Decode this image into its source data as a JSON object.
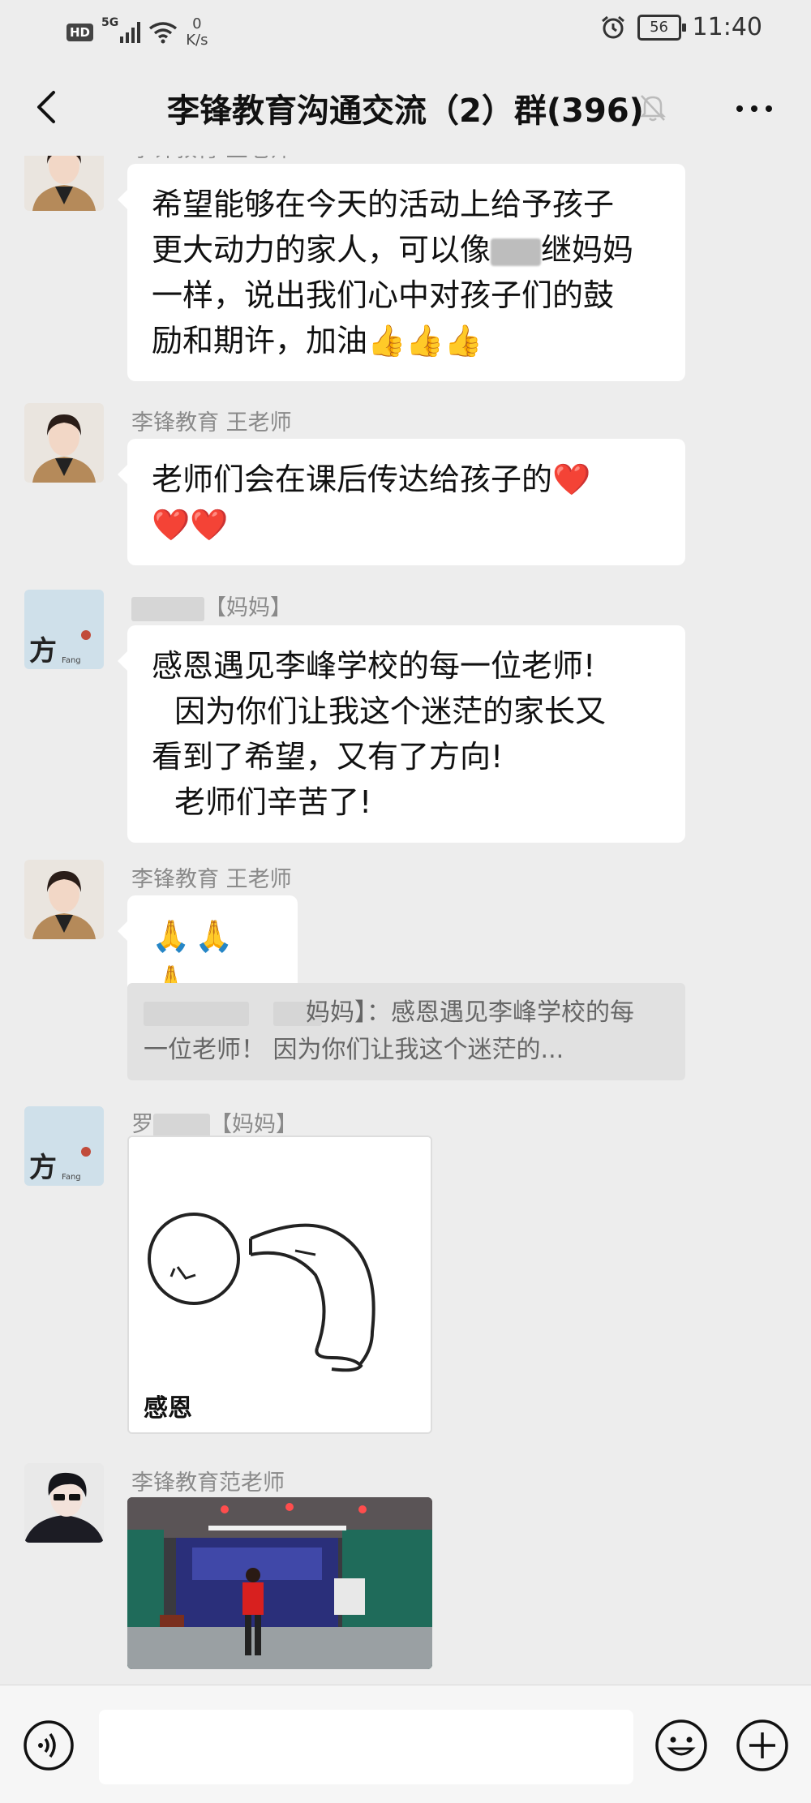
{
  "status_bar": {
    "hd": "HD",
    "network": "5G",
    "speed_value": "0",
    "speed_unit": "K/s",
    "battery": "56",
    "time": "11:40"
  },
  "header": {
    "title": "李锋教育沟通交流（2）群(396)"
  },
  "messages": [
    {
      "sender": "李锋教育 王老师",
      "lines": [
        "希望能够在今天的活动上给予孩子",
        "更大动力的家人，可以像",
        "继妈妈",
        "一样，说出我们心中对孩子们的鼓",
        "励和期许，加油👍👍👍"
      ]
    },
    {
      "sender": "李锋教育 王老师",
      "lines": [
        "老师们会在课后传达给孩子的❤️",
        "❤️❤️"
      ]
    },
    {
      "sender_suffix": "【妈妈】",
      "avatar_text": "方",
      "avatar_subtext": "Fang",
      "lines": [
        "感恩遇见李峰学校的每一位老师!",
        "因为你们让我这个迷茫的家长又",
        "看到了希望，又有了方向!",
        "老师们辛苦了!"
      ]
    },
    {
      "sender": "李锋教育 王老师",
      "lines": [
        "🙏🙏🙏"
      ],
      "quote": {
        "line1_suffix": "妈妈】：感恩遇见李峰学校的每",
        "line2": "一位老师！     因为你们让我这个迷茫的..."
      }
    },
    {
      "sender_prefix": "罗",
      "sender_suffix": "【妈妈】",
      "avatar_text": "方",
      "avatar_subtext": "Fang",
      "sticker_caption": "感恩"
    },
    {
      "sender": "李锋教育范老师"
    }
  ],
  "input": {
    "placeholder": ""
  },
  "icons": {
    "back": "back-arrow-icon",
    "mute": "bell-muted-icon",
    "more": "more-dots-icon",
    "voice": "voice-icon",
    "emoji": "emoji-icon",
    "plus": "plus-icon"
  },
  "colors": {
    "background": "#ededed",
    "bubble": "#ffffff",
    "sender": "#8a8a8a",
    "quote_bg": "#e1e1e1"
  }
}
